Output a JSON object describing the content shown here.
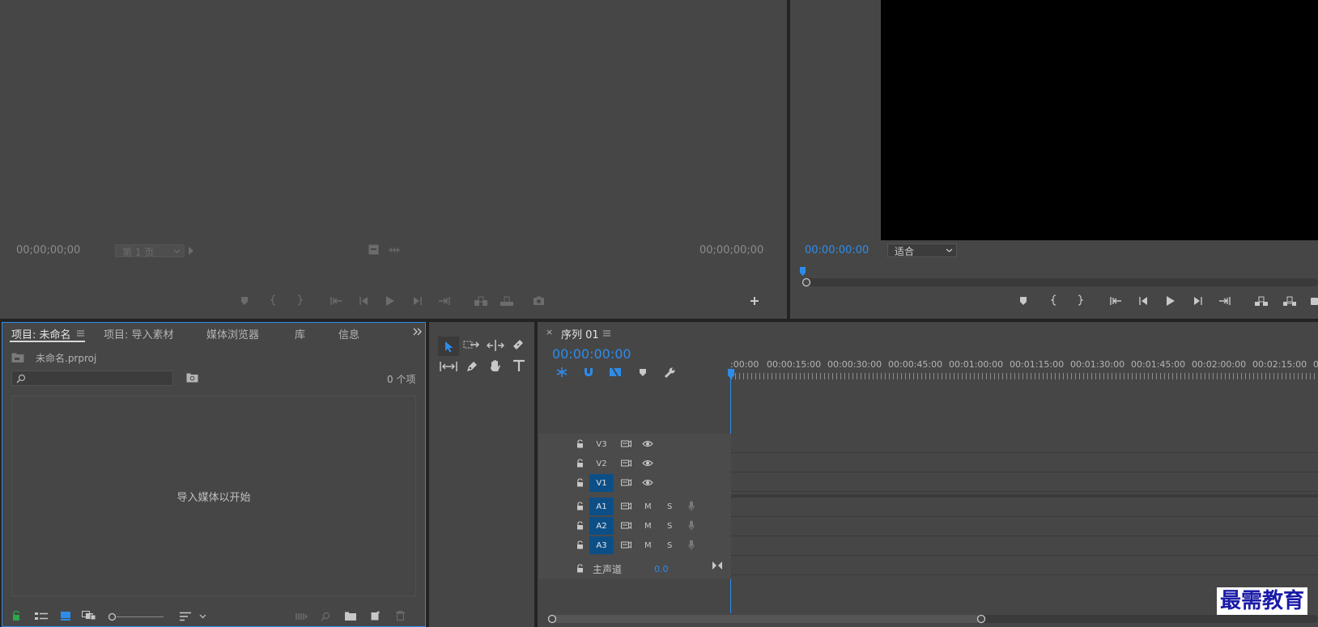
{
  "source_monitor": {
    "timecode_left": "00;00;00;00",
    "page_select": "第 1 页",
    "timecode_right": "00;00;00;00"
  },
  "program_monitor": {
    "timecode": "00:00:00:00",
    "zoom_select": "适合"
  },
  "project_panel": {
    "tabs": [
      {
        "label": "项目: 未命名"
      },
      {
        "label": "项目: 导入素材"
      },
      {
        "label": "媒体浏览器"
      },
      {
        "label": "库"
      },
      {
        "label": "信息"
      }
    ],
    "project_file": "未命名.prproj",
    "search_placeholder": "",
    "item_count": "0 个项",
    "empty_message": "导入媒体以开始"
  },
  "timeline": {
    "sequence_tab": "序列 01",
    "close_glyph": "×",
    "timecode": "00:00:00:00",
    "ruler": [
      ":00:00",
      "00:00:15:00",
      "00:00:30:00",
      "00:00:45:00",
      "00:01:00:00",
      "00:01:15:00",
      "00:01:30:00",
      "00:01:45:00",
      "00:02:00:00",
      "00:02:15:00",
      "0"
    ],
    "video_tracks": [
      {
        "label": "V3",
        "active": false
      },
      {
        "label": "V2",
        "active": false
      },
      {
        "label": "V1",
        "active": true
      }
    ],
    "audio_tracks": [
      {
        "label": "A1"
      },
      {
        "label": "A2"
      },
      {
        "label": "A3"
      }
    ],
    "mute_label": "M",
    "solo_label": "S",
    "master_label": "主声道",
    "master_value": "0.0"
  },
  "watermark": "最需教育",
  "colors": {
    "accent_blue": "#2d8ceb",
    "track_active": "#0c4f87",
    "panel_bg": "#464646",
    "frame_bg": "#232323",
    "program_video": "#000000",
    "watermark_blue": "#1a1aa8"
  }
}
